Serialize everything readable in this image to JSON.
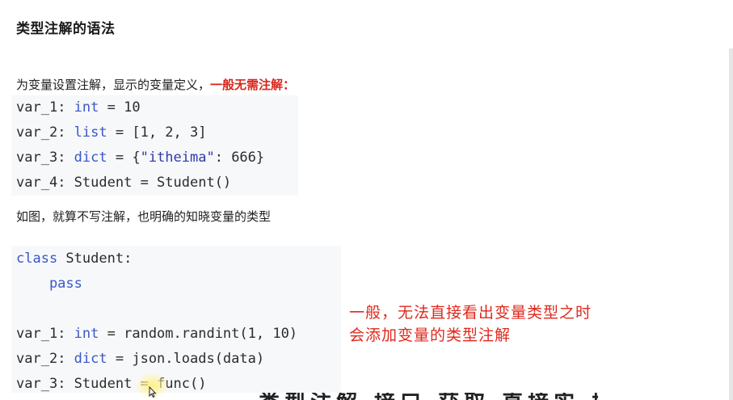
{
  "heading": "类型注解的语法",
  "intro": {
    "text": "为变量设置注解，显示的变量定义，",
    "highlight": "一般无需注解："
  },
  "top_code": [
    {
      "name": "var_1",
      "colon": ": ",
      "type": "int",
      "eq": " = ",
      "value": "10"
    },
    {
      "name": "var_2",
      "colon": ": ",
      "type": "list",
      "eq": " = ",
      "value": "[1, 2, 3]"
    },
    {
      "name": "var_3",
      "colon": ": ",
      "type": "dict",
      "eq": " = ",
      "value_open": "{",
      "value_str": "\"itheima\"",
      "value_rest": ": 666}"
    },
    {
      "name": "var_4",
      "colon": ": ",
      "type": "Student",
      "eq": " = ",
      "value": "Student()"
    }
  ],
  "caption": "如图，就算不写注解，也明确的知晓变量的类型",
  "bottom_code": {
    "class_kw": "class",
    "class_name": " Student:",
    "pass_line": "    pass",
    "lines": [
      {
        "name": "var_1",
        "colon": ": ",
        "type": "int",
        "eq": " = ",
        "value": "random.randint(1, 10)"
      },
      {
        "name": "var_2",
        "colon": ": ",
        "type": "dict",
        "eq": " = ",
        "value": "json.loads(data)"
      },
      {
        "name": "var_3",
        "colon": ": ",
        "type": "Student",
        "eq": " = ",
        "value": "func()"
      }
    ]
  },
  "annotation": {
    "line1": "一般，无法直接看出变量类型之时",
    "line2": "会添加变量的类型注解"
  },
  "cut_off_text": "类型注解 接口 获取 直接实 操"
}
